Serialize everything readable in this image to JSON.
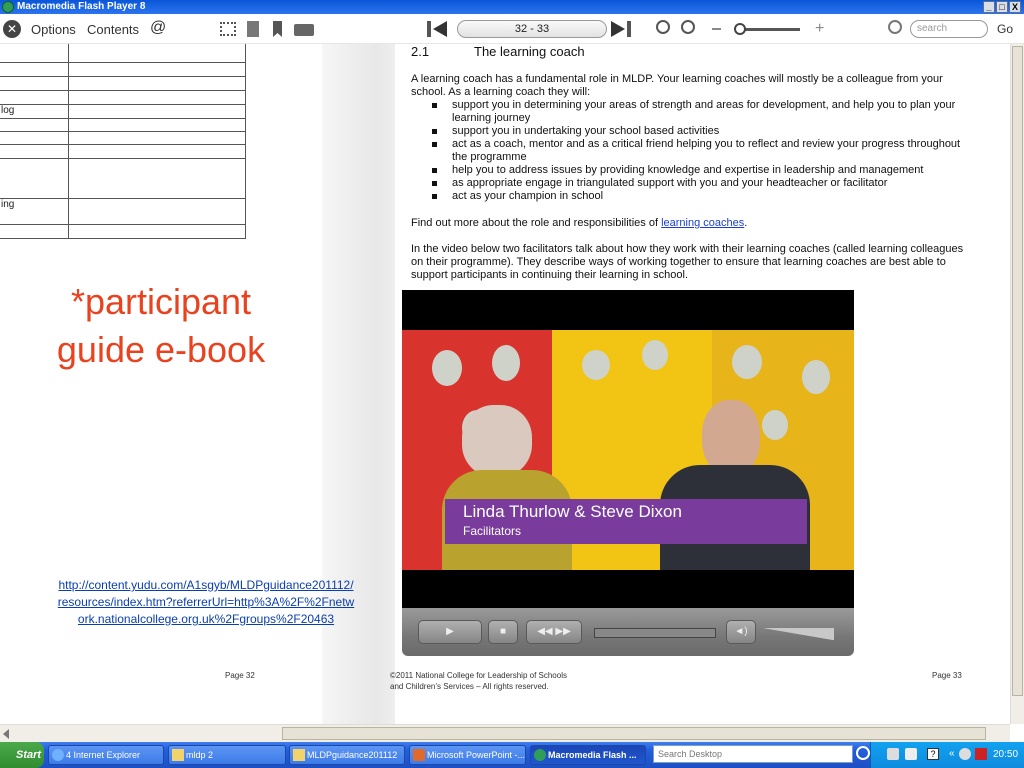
{
  "window": {
    "title": "Macromedia Flash Player 8",
    "buttons": [
      "_",
      "□",
      "X"
    ]
  },
  "toolbar": {
    "options_label": "Options",
    "contents_label": "Contents",
    "at_label": "@",
    "page_indicator": "32 - 33",
    "search_placeholder": "search",
    "go_label": "Go"
  },
  "left_page": {
    "table_cells": [
      "log",
      "ing"
    ],
    "callout": [
      "*participant",
      "guide e-book"
    ],
    "url_lines": [
      "http://content.yudu.com/A1sgyb/MLDPguidance201112/",
      "resources/index.htm?referrerUrl=http%3A%2F%2Fnetw",
      "ork.nationalcollege.org.uk%2Fgroups%2F20463"
    ],
    "page_label": "Page 32"
  },
  "right_page": {
    "section_number": "2.1",
    "section_title": "The learning coach",
    "intro": "A learning coach has a fundamental role in MLDP. Your learning coaches will mostly be a colleague from your school. As a learning coach they will:",
    "bullets": [
      "support you in determining your areas of strength and areas for development, and help you to plan your learning journey",
      "support you in undertaking your school based activities",
      "act as a coach, mentor and as a critical friend helping you to reflect and review your progress throughout the programme",
      "help you to address issues by providing knowledge and expertise in leadership and management",
      "as appropriate engage in triangulated support with you and your headteacher or facilitator",
      "act as your champion in school"
    ],
    "find_out_prefix": "Find out more about the role and responsibilities of ",
    "find_out_link": "learning coaches",
    "find_out_suffix": ".",
    "video_intro": "In the video below two facilitators talk about how they work with their learning coaches (called learning colleagues on their programme). They describe ways of working together to ensure that learning coaches are best able to support participants in continuing their learning in school.",
    "video_caption_name": "Linda Thurlow & Steve Dixon",
    "video_caption_role": "Facilitators",
    "copyright_line1": "©2011 National College for Leadership of Schools",
    "copyright_line2": "and Children’s Services – All rights reserved.",
    "page_label": "Page 33"
  },
  "video_controls": {
    "play_label": "▶",
    "stop_label": "■",
    "rewind_label": "◀◀",
    "forward_label": "▶▶"
  },
  "taskbar": {
    "start_label": "Start",
    "tasks": [
      {
        "label": "4 Internet Explorer",
        "icon": "ie-icon"
      },
      {
        "label": "mldp 2",
        "icon": "folder-icon"
      },
      {
        "label": "MLDPguidance201112",
        "icon": "folder-icon"
      },
      {
        "label": "Microsoft PowerPoint -...",
        "icon": "powerpoint-icon"
      },
      {
        "label": "Macromedia Flash ...",
        "icon": "flash-icon"
      }
    ],
    "search_placeholder": "Search Desktop",
    "clock": "20:50"
  }
}
